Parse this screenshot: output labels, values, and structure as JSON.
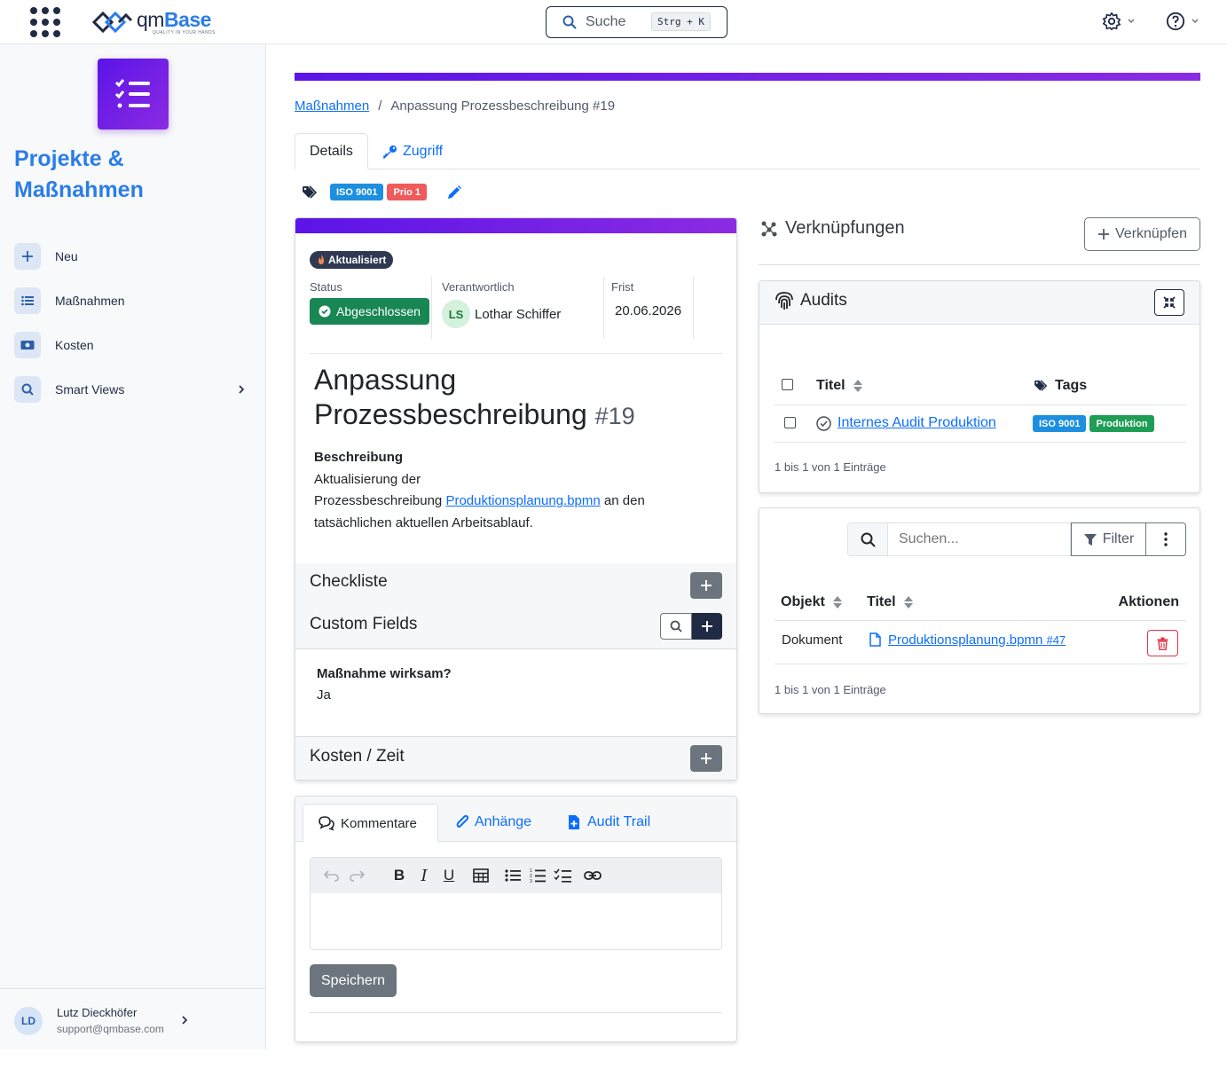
{
  "topbar": {
    "logo_brand_a": "qm",
    "logo_brand_b": "Base",
    "logo_tagline": "QUALITY IN YOUR HANDS",
    "search_label": "Suche",
    "search_shortcut": "Strg + K"
  },
  "sidebar": {
    "app_title": "Projekte & Maßnahmen",
    "items": [
      {
        "label": "Neu",
        "icon": "plus-icon"
      },
      {
        "label": "Maßnahmen",
        "icon": "list-icon"
      },
      {
        "label": "Kosten",
        "icon": "money-icon"
      },
      {
        "label": "Smart Views",
        "icon": "search-icon"
      }
    ],
    "user": {
      "initials": "LD",
      "name": "Lutz Dieckhöfer",
      "email": "support@qmbase.com"
    }
  },
  "breadcrumb": {
    "root": "Maßnahmen",
    "separator": "/",
    "current": "Anpassung Prozessbeschreibung #19"
  },
  "tabs": {
    "details": "Details",
    "access": "Zugriff"
  },
  "tags": [
    {
      "label": "ISO 9001",
      "color": "#1d8fe0"
    },
    {
      "label": "Prio 1",
      "color": "#ef5a5a"
    }
  ],
  "measure": {
    "updated_badge": "Aktualisiert",
    "status_label": "Status",
    "status_value": "Abgeschlossen",
    "owner_label": "Verantwortlich",
    "owner_initials": "LS",
    "owner_name": "Lothar Schiffer",
    "deadline_label": "Frist",
    "deadline_value": "20.06.2026",
    "title_line1": "Anpassung",
    "title_line2": "Prozessbeschreibung",
    "number": "#19",
    "description_label": "Beschreibung",
    "description_part1": "Aktualisierung der",
    "description_part2": "Prozessbeschreibung",
    "description_link": "Produktionsplanung.bpmn",
    "description_part3": "an den",
    "description_part4": "tatsächlichen aktuellen Arbeitsablauf.",
    "checklist_title": "Checkliste",
    "custom_fields_title": "Custom Fields",
    "cf_question": "Maßnahme wirksam?",
    "cf_answer": "Ja",
    "cost_title": "Kosten / Zeit"
  },
  "comments": {
    "tab_comments": "Kommentare",
    "tab_attachments": "Anhänge",
    "tab_audit": "Audit Trail",
    "save_label": "Speichern"
  },
  "links": {
    "title": "Verknüpfungen",
    "link_button": "Verknüpfen",
    "audits": {
      "title": "Audits",
      "col_title": "Titel",
      "col_tags": "Tags",
      "row_title": "Internes Audit Produktion",
      "row_tags": [
        {
          "label": "ISO 9001",
          "color": "#1d8fe0"
        },
        {
          "label": "Produktion",
          "color": "#1e9e55"
        }
      ],
      "footer": "1 bis 1 von 1 Einträge"
    },
    "objects": {
      "search_placeholder": "Suchen...",
      "filter_label": "Filter",
      "col_object": "Objekt",
      "col_title": "Titel",
      "col_actions": "Aktionen",
      "row_object": "Dokument",
      "row_title": "Produktionsplanung.bpmn",
      "row_number": "#47",
      "footer": "1 bis 1 von 1 Einträge"
    }
  }
}
